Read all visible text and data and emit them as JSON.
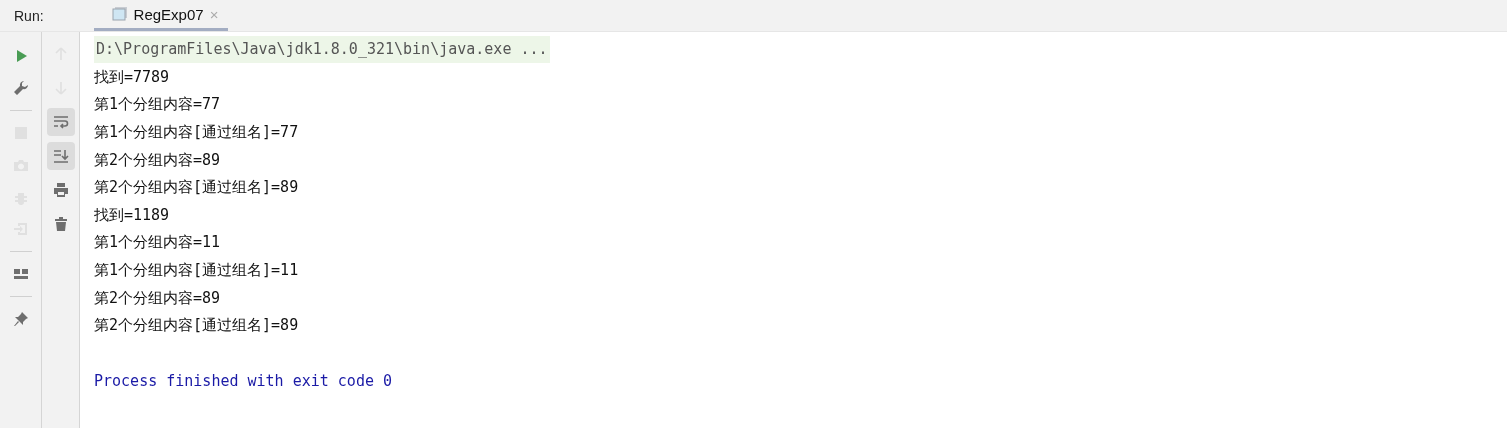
{
  "run_bar": {
    "label": "Run:",
    "tabs": [
      {
        "title": "RegExp07",
        "selected": true,
        "close": "×"
      }
    ]
  },
  "main_toolbar": [
    {
      "kind": "run",
      "disabled": false
    },
    {
      "kind": "wrench",
      "disabled": false
    },
    {
      "kind": "separator"
    },
    {
      "kind": "stop",
      "disabled": true
    },
    {
      "kind": "camera",
      "disabled": true
    },
    {
      "kind": "bug",
      "disabled": true
    },
    {
      "kind": "exit",
      "disabled": true
    },
    {
      "kind": "separator"
    },
    {
      "kind": "layout",
      "disabled": false
    },
    {
      "kind": "separator"
    },
    {
      "kind": "pin",
      "disabled": false
    }
  ],
  "console_toolbar": [
    {
      "kind": "up",
      "disabled": true,
      "toggled": false
    },
    {
      "kind": "down",
      "disabled": true,
      "toggled": false
    },
    {
      "kind": "wrap",
      "disabled": false,
      "toggled": true
    },
    {
      "kind": "scroll",
      "disabled": false,
      "toggled": true
    },
    {
      "kind": "print",
      "disabled": false,
      "toggled": false
    },
    {
      "kind": "trash",
      "disabled": false,
      "toggled": false
    }
  ],
  "console": [
    {
      "kind": "command",
      "text": "D:\\ProgramFiles\\Java\\jdk1.8.0_321\\bin\\java.exe ..."
    },
    {
      "kind": "stdout",
      "text": "找到=7789"
    },
    {
      "kind": "stdout",
      "text": "第1个分组内容=77"
    },
    {
      "kind": "stdout",
      "text": "第1个分组内容[通过组名]=77"
    },
    {
      "kind": "stdout",
      "text": "第2个分组内容=89"
    },
    {
      "kind": "stdout",
      "text": "第2个分组内容[通过组名]=89"
    },
    {
      "kind": "stdout",
      "text": "找到=1189"
    },
    {
      "kind": "stdout",
      "text": "第1个分组内容=11"
    },
    {
      "kind": "stdout",
      "text": "第1个分组内容[通过组名]=11"
    },
    {
      "kind": "stdout",
      "text": "第2个分组内容=89"
    },
    {
      "kind": "stdout",
      "text": "第2个分组内容[通过组名]=89"
    },
    {
      "kind": "blank"
    },
    {
      "kind": "exit",
      "text": "Process finished with exit code 0"
    }
  ]
}
